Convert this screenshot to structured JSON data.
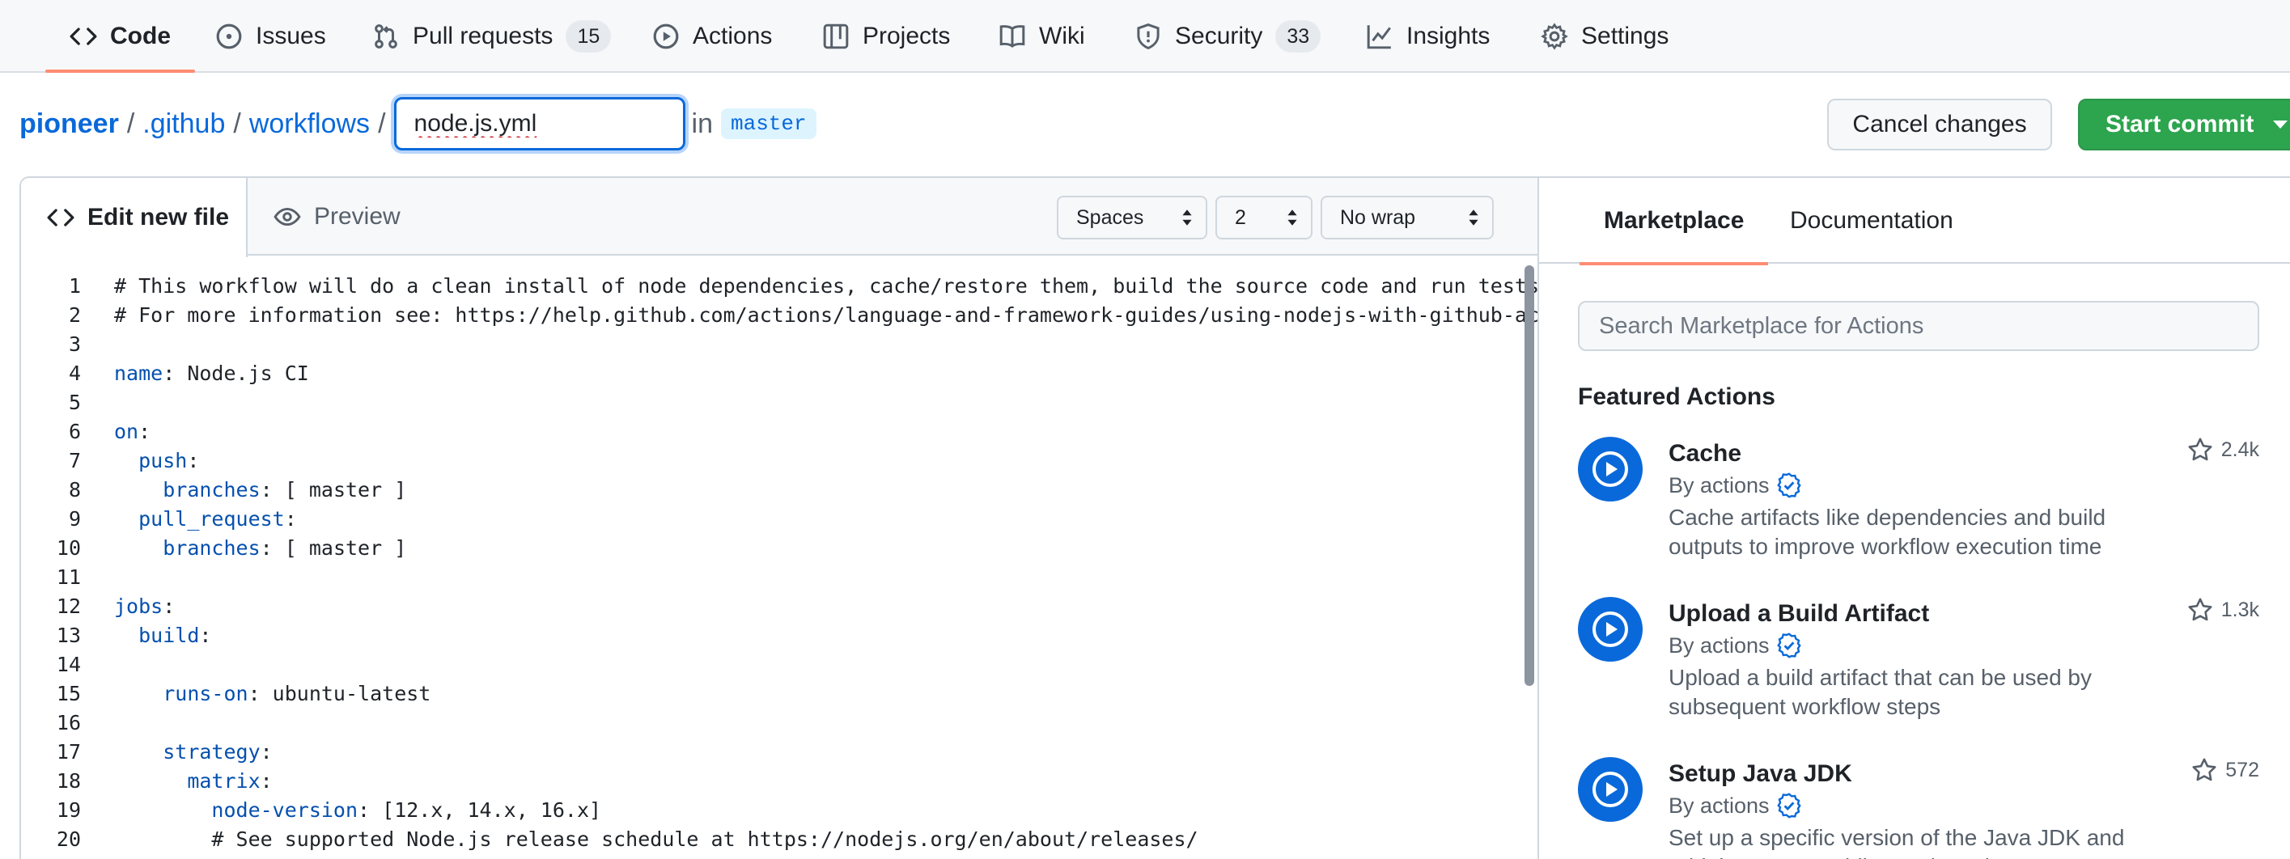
{
  "repo_nav": {
    "items": [
      {
        "label": "Code",
        "icon": "code-icon",
        "active": true
      },
      {
        "label": "Issues",
        "icon": "issue-opened-icon"
      },
      {
        "label": "Pull requests",
        "icon": "git-pull-request-icon",
        "counter": "15"
      },
      {
        "label": "Actions",
        "icon": "play-icon"
      },
      {
        "label": "Projects",
        "icon": "table-icon"
      },
      {
        "label": "Wiki",
        "icon": "book-icon"
      },
      {
        "label": "Security",
        "icon": "shield-icon",
        "counter": "33"
      },
      {
        "label": "Insights",
        "icon": "graph-icon"
      },
      {
        "label": "Settings",
        "icon": "gear-icon"
      }
    ]
  },
  "breadcrumb": {
    "owner": "pioneer",
    "sep": "/",
    "dir1": ".github",
    "dir2": "workflows",
    "filename": "node.js.yml",
    "in_text": "in",
    "branch": "master"
  },
  "buttons": {
    "cancel": "Cancel changes",
    "commit": "Start commit"
  },
  "editor": {
    "tab_edit": "Edit new file",
    "tab_preview": "Preview",
    "indent_mode": "Spaces",
    "indent_size": "2",
    "wrap_mode": "No wrap",
    "lines": [
      {
        "n": "1",
        "text": "# This workflow will do a clean install of node dependencies, cache/restore them, build the source code and run tests across different versions of node"
      },
      {
        "n": "2",
        "text": "# For more information see: https://help.github.com/actions/language-and-framework-guides/using-nodejs-with-github-actions"
      },
      {
        "n": "3",
        "text": ""
      },
      {
        "n": "4",
        "key": "name",
        "text": ": Node.js CI"
      },
      {
        "n": "5",
        "text": ""
      },
      {
        "n": "6",
        "key": "on",
        "text": ":"
      },
      {
        "n": "7",
        "indent": "  ",
        "key": "push",
        "text": ":"
      },
      {
        "n": "8",
        "indent": "    ",
        "key": "branches",
        "text": ": [ master ]"
      },
      {
        "n": "9",
        "indent": "  ",
        "key": "pull_request",
        "text": ":"
      },
      {
        "n": "10",
        "indent": "    ",
        "key": "branches",
        "text": ": [ master ]"
      },
      {
        "n": "11",
        "text": ""
      },
      {
        "n": "12",
        "key": "jobs",
        "text": ":"
      },
      {
        "n": "13",
        "indent": "  ",
        "key": "build",
        "text": ":"
      },
      {
        "n": "14",
        "text": ""
      },
      {
        "n": "15",
        "indent": "    ",
        "key": "runs-on",
        "text": ": ubuntu-latest"
      },
      {
        "n": "16",
        "text": ""
      },
      {
        "n": "17",
        "indent": "    ",
        "key": "strategy",
        "text": ":"
      },
      {
        "n": "18",
        "indent": "      ",
        "key": "matrix",
        "text": ":"
      },
      {
        "n": "19",
        "indent": "        ",
        "key": "node-version",
        "text": ": [12.x, 14.x, 16.x]"
      },
      {
        "n": "20",
        "indent": "        ",
        "text": "# See supported Node.js release schedule at https://nodejs.org/en/about/releases/"
      }
    ]
  },
  "sidebar": {
    "tab_marketplace": "Marketplace",
    "tab_documentation": "Documentation",
    "search_placeholder": "Search Marketplace for Actions",
    "featured_title": "Featured Actions",
    "actions": [
      {
        "name": "Cache",
        "by": "By actions",
        "desc": "Cache artifacts like dependencies and build outputs to improve workflow execution time",
        "stars": "2.4k"
      },
      {
        "name": "Upload a Build Artifact",
        "by": "By actions",
        "desc": "Upload a build artifact that can be used by subsequent workflow steps",
        "stars": "1.3k"
      },
      {
        "name": "Setup Java JDK",
        "by": "By actions",
        "desc": "Set up a specific version of the Java JDK and add the command-line tools to the PATH",
        "stars": "572"
      }
    ]
  },
  "colors": {
    "accent": "#0969da",
    "commit_green": "#2da44e",
    "tab_underline": "#fd8c73"
  }
}
